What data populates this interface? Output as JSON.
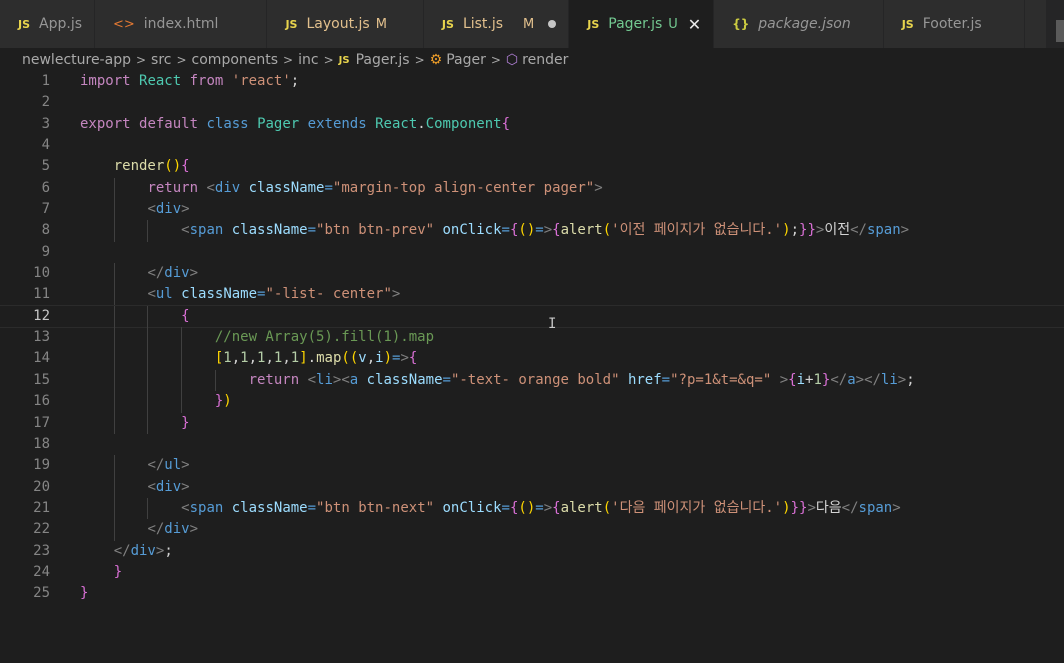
{
  "tabs": [
    {
      "icon": "JS",
      "label": "App.js",
      "state": "normal",
      "badge": ""
    },
    {
      "icon": "<>",
      "label": "index.html",
      "state": "normal",
      "badge": ""
    },
    {
      "icon": "JS",
      "label": "Layout.js",
      "state": "modified",
      "badge": "M"
    },
    {
      "icon": "JS",
      "label": "List.js",
      "state": "modified",
      "badge": "M"
    },
    {
      "icon": "JS",
      "label": "Pager.js",
      "state": "untracked",
      "badge": "U"
    },
    {
      "icon": "{}",
      "label": "package.json",
      "state": "italic",
      "badge": ""
    },
    {
      "icon": "JS",
      "label": "Footer.js",
      "state": "normal",
      "badge": ""
    }
  ],
  "breadcrumb": {
    "parts": [
      "newlecture-app",
      "src",
      "components",
      "inc"
    ],
    "file_icon": "JS",
    "file": "Pager.js",
    "class_icon": "class-icon",
    "class": "Pager",
    "method_icon": "method-icon",
    "method": "render",
    "separator": ">"
  },
  "editor": {
    "current_line": 12,
    "line_numbers": [
      "1",
      "2",
      "3",
      "4",
      "5",
      "6",
      "7",
      "8",
      "9",
      "10",
      "11",
      "12",
      "13",
      "14",
      "15",
      "16",
      "17",
      "18",
      "19",
      "20",
      "21",
      "22",
      "23",
      "24",
      "25"
    ],
    "lines": [
      "import React from 'react';",
      "",
      "export default class Pager extends React.Component{",
      "",
      "    render(){",
      "        return <div className=\"margin-top align-center pager\">",
      "        <div>",
      "            <span className=\"btn btn-prev\" onClick={()=>{alert('이전 페이지가 없습니다.');}}>이전</span>",
      "",
      "        </div>",
      "        <ul className=\"-list- center\">",
      "            {",
      "                //new Array(5).fill(1).map",
      "                [1,1,1,1,1].map((v,i)=>{",
      "                    return <li><a className=\"-text- orange bold\" href=\"?p=1&t=&q=\" >{i+1}</a></li>;",
      "                })",
      "            }",
      "",
      "        </ul>",
      "        <div>",
      "            <span className=\"btn btn-next\" onClick={()=>{alert('다음 페이지가 없습니다.')}}>다음</span>",
      "        </div>",
      "    </div>;",
      "    }",
      "}"
    ]
  },
  "colors": {
    "background": "#1e1e1e",
    "keyword": "#569cd6",
    "control": "#c586c0",
    "string": "#ce9178",
    "type": "#4ec9b0",
    "function": "#dcdcaa",
    "attribute": "#9cdcfe",
    "comment": "#6a9955",
    "number": "#b5cea8"
  }
}
